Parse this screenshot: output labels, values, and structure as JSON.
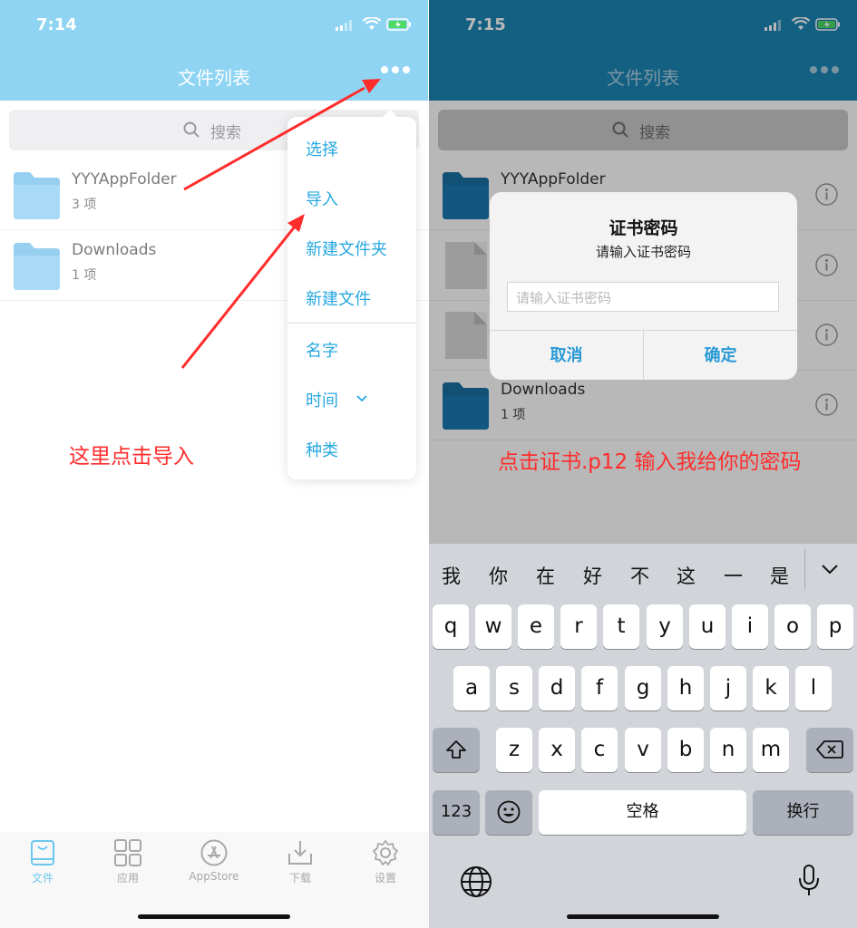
{
  "colors": {
    "nav_left": "#8fd5f3",
    "nav_right": "#1c86b4",
    "accent": "#28a8e0",
    "annotation": "#ff2c2c"
  },
  "left": {
    "status": {
      "time": "7:14"
    },
    "nav_title": "文件列表",
    "search_placeholder": "搜索",
    "rows": [
      {
        "name": "YYYAppFolder",
        "count": "3 项",
        "icon": "folder-icon"
      },
      {
        "name": "Downloads",
        "count": "1 项",
        "icon": "folder-icon"
      }
    ],
    "menu": {
      "items": [
        "选择",
        "导入",
        "新建文件夹",
        "新建文件"
      ],
      "sort_items": [
        "名字",
        "时间",
        "种类"
      ]
    },
    "annotation": "这里点击导入",
    "tabs": [
      {
        "label": "文件",
        "icon": "file-tab-icon",
        "active": true
      },
      {
        "label": "应用",
        "icon": "grid-icon",
        "active": false
      },
      {
        "label": "AppStore",
        "icon": "appstore-icon",
        "active": false
      },
      {
        "label": "下载",
        "icon": "download-icon",
        "active": false
      },
      {
        "label": "设置",
        "icon": "gear-icon",
        "active": false
      }
    ]
  },
  "right": {
    "status": {
      "time": "7:15"
    },
    "nav_title": "文件列表",
    "search_placeholder": "搜索",
    "rows": [
      {
        "name": "YYYAppFolder"
      },
      {
        "name": ""
      },
      {
        "name": ""
      },
      {
        "name": "Downloads",
        "count": "1 项"
      }
    ],
    "alert": {
      "title": "证书密码",
      "message": "请输入证书密码",
      "input_placeholder": "请输入证书密码",
      "cancel": "取消",
      "confirm": "确定"
    },
    "annotation": "点击证书.p12 输入我给你的密码",
    "keyboard": {
      "candidates": [
        "我",
        "你",
        "在",
        "好",
        "不",
        "这",
        "一",
        "是"
      ],
      "row1": [
        "q",
        "w",
        "e",
        "r",
        "t",
        "y",
        "u",
        "i",
        "o",
        "p"
      ],
      "row2": [
        "a",
        "s",
        "d",
        "f",
        "g",
        "h",
        "j",
        "k",
        "l"
      ],
      "row3": [
        "z",
        "x",
        "c",
        "v",
        "b",
        "n",
        "m"
      ],
      "numbers_key": "123",
      "space_key": "空格",
      "return_key": "换行"
    }
  }
}
